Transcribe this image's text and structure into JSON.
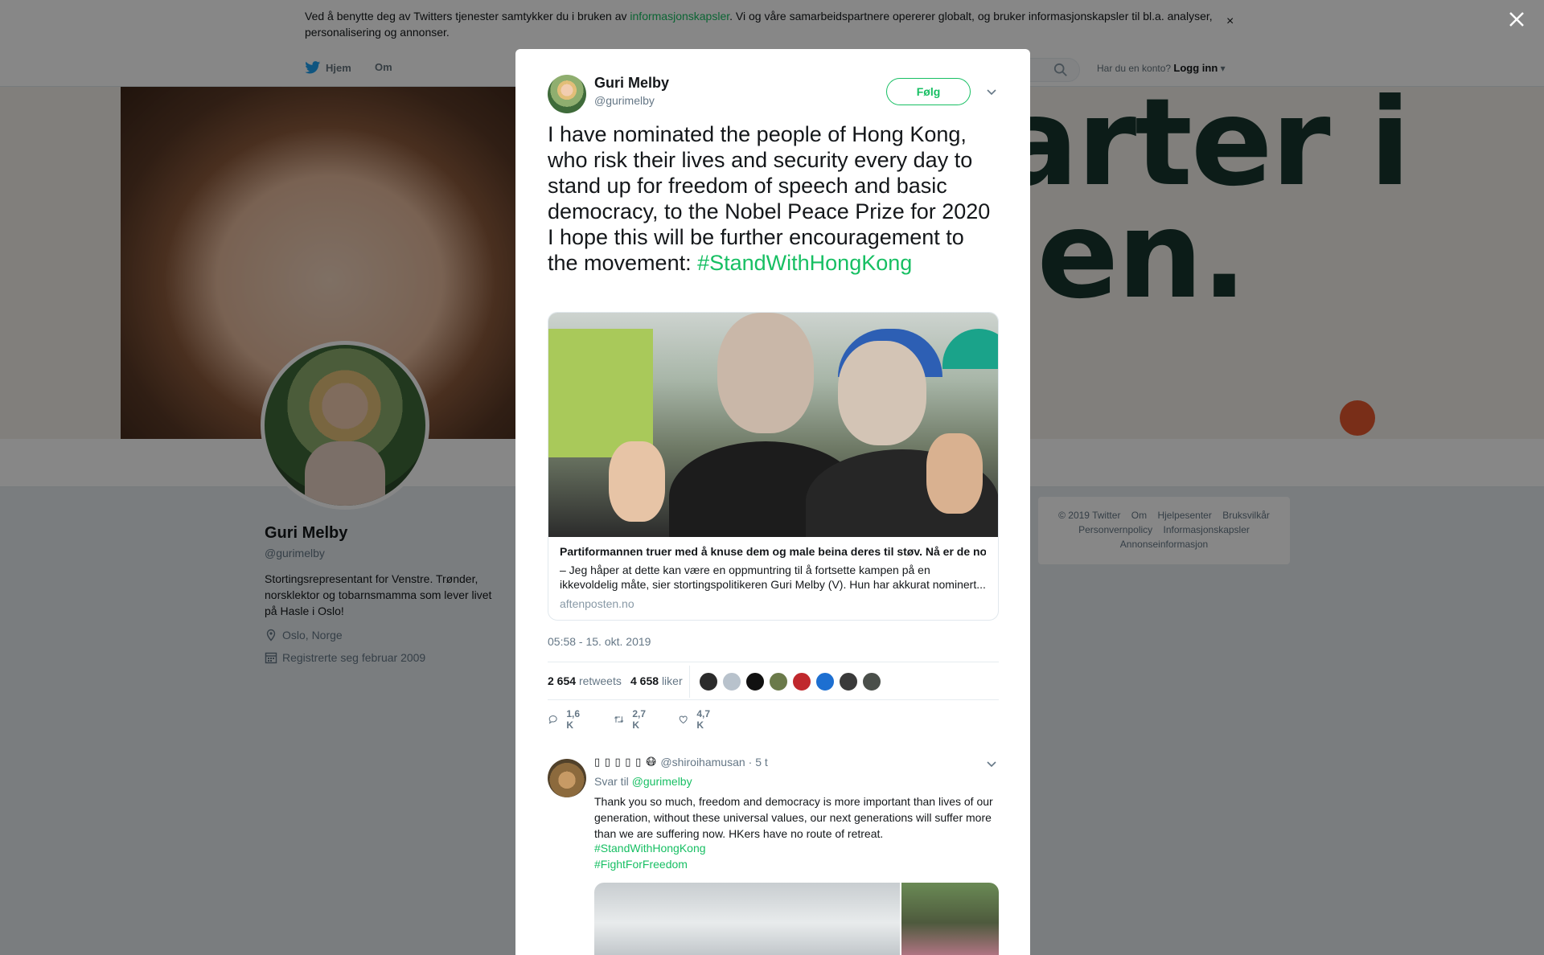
{
  "cookie_bar": {
    "text_before": "Ved å benytte deg av Twitters tjenester samtykker du i bruken av ",
    "link": "informasjonskapsler",
    "text_after": ". Vi og våre samarbeidspartnere opererer globalt, og bruker informasjonskapsler til bl.a. analyser, personalisering og annonser.",
    "close": "×"
  },
  "nav": {
    "home": "Hjem",
    "about": "Om",
    "login_prompt": "Har du en konto?",
    "login": "Logg inn"
  },
  "profile": {
    "name": "Guri Melby",
    "handle": "@gurimelby",
    "bio": "Stortingsrepresentant for Venstre. Trønder, norsklektor og tobarnsmamma som lever livet på Hasle i Oslo!",
    "location": "Oslo, Norge",
    "joined": "Registrerte seg februar 2009"
  },
  "footer": {
    "links": [
      "© 2019 Twitter",
      "Om",
      "Hjelpesenter",
      "Bruksvilkår",
      "Personvernpolicy",
      "Informasjonskapsler",
      "Annonseinformasjon"
    ]
  },
  "banner": {
    "text_line1": "arter i",
    "text_line2": "len."
  },
  "tweet": {
    "author_name": "Guri Melby",
    "author_handle": "@gurimelby",
    "follow_label": "Følg",
    "text": "I have nominated the people of Hong Kong, who risk their lives and security every day to stand up for freedom of speech and basic democracy, to the Nobel Peace Prize for 2020 I hope this will be further encouragement to the movement: ",
    "hashtag": "#StandWithHongKong",
    "card": {
      "title": "Partiformannen truer med å knuse dem og male beina deres til støv. Nå er de nominert til Nobels fredspris.",
      "description": "– Jeg håper at dette kan være en oppmuntring til å fortsette kampen på en ikkevoldelig måte, sier stortingspolitikeren Guri Melby (V). Hun har akkurat nominert...",
      "domain": "aftenposten.no"
    },
    "timestamp": "05:58 - 15. okt. 2019",
    "retweets_count": "2 654",
    "retweets_label": "retweets",
    "likes_count": "4 658",
    "likes_label": "liker",
    "liker_colors": [
      "#2b2b2b",
      "#b8c2cc",
      "#111111",
      "#6b7a4a",
      "#c0282d",
      "#1d6fd1",
      "#3a3a3a",
      "#4a4f4a"
    ],
    "actions": {
      "replies": "1,6 K",
      "retweets": "2,7 K",
      "likes": "4,7 K"
    }
  },
  "reply": {
    "name": "▯ ▯ ▯ ▯ ▯ 😷",
    "handle": "@shiroihamusan",
    "time": "· 5 t",
    "reply_to_label": "Svar til",
    "reply_to_mention": "@gurimelby",
    "text": "Thank you so much, freedom and democracy is more important than lives of our generation, without these universal values, our next generations will suffer more than we are suffering now. HKers have no route of retreat.",
    "tags": [
      "#StandWithHongKong",
      "#FightForFreedom"
    ]
  }
}
